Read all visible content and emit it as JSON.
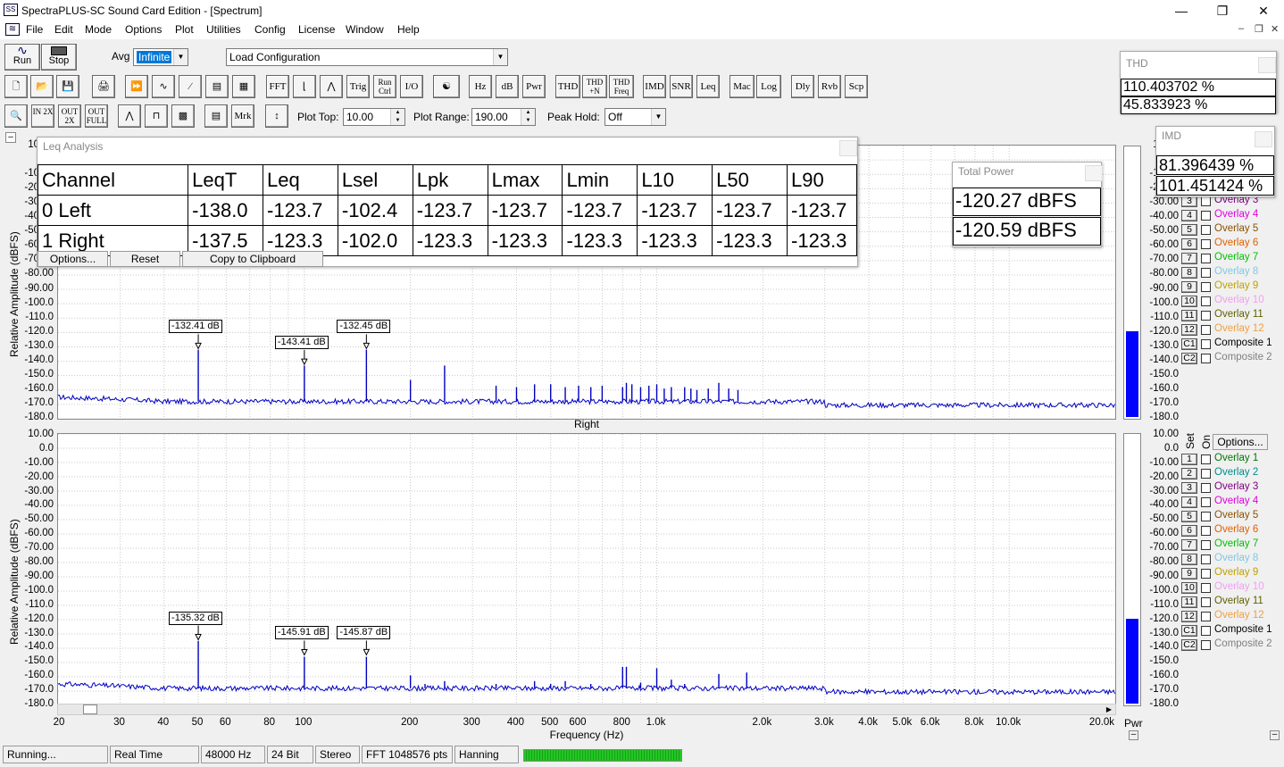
{
  "window": {
    "title": "SpectraPLUS-SC Sound Card Edition - [Spectrum]",
    "icon_text": "SS"
  },
  "menu": [
    "File",
    "Edit",
    "Mode",
    "Options",
    "Plot",
    "Utilities",
    "Config",
    "License",
    "Window",
    "Help"
  ],
  "toolbar1": {
    "run": "Run",
    "stop": "Stop",
    "avg_label": "Avg",
    "avg_value": "Infinite",
    "config_value": "Load Configuration"
  },
  "toolbar2": [
    "FFT",
    "Trig",
    "Run Ctrl",
    "I/O",
    "Hz",
    "dB",
    "Pwr",
    "THD",
    "THD +N",
    "THD Freq",
    "IMD",
    "SNR",
    "Leq",
    "Mac",
    "Log",
    "Dly",
    "Rvb",
    "Scp"
  ],
  "toolbar3": {
    "zoom_in": "IN 2X",
    "zoom_out": "OUT 2X",
    "zoom_full": "OUT FULL",
    "mrk": "Mrk",
    "plot_top_label": "Plot Top:",
    "plot_top_value": "10.00",
    "plot_range_label": "Plot Range:",
    "plot_range_value": "190.00",
    "peak_hold_label": "Peak Hold:",
    "peak_hold_value": "Off"
  },
  "thd": {
    "title": "THD",
    "values": [
      "110.403702 %",
      "45.833923 %"
    ]
  },
  "imd": {
    "title": "IMD",
    "values": [
      "81.396439 %",
      "101.451424 %"
    ]
  },
  "total_power": {
    "title": "Total Power",
    "values": [
      "-120.27 dBFS",
      "-120.59 dBFS"
    ]
  },
  "leq": {
    "title": "Leq Analysis",
    "headers": [
      "Channel",
      "LeqT",
      "Leq",
      "Lsel",
      "Lpk",
      "Lmax",
      "Lmin",
      "L10",
      "L50",
      "L90"
    ],
    "rows": [
      [
        "0 Left",
        "-138.0",
        "-123.7",
        "-102.4",
        "-123.7",
        "-123.7",
        "-123.7",
        "-123.7",
        "-123.7",
        "-123.7"
      ],
      [
        "1 Right",
        "-137.5",
        "-123.3",
        "-102.0",
        "-123.3",
        "-123.3",
        "-123.3",
        "-123.3",
        "-123.3",
        "-123.3"
      ]
    ],
    "buttons": [
      "Options...",
      "Reset",
      "Copy to Clipboard"
    ]
  },
  "plots": {
    "ylabel": "Relative Amplitude (dBFS)",
    "right_title": "Right",
    "xlabel": "Frequency (Hz)",
    "pwr_label": "Pwr",
    "left_yticks": [
      "10.00",
      "0.0",
      "-10.00",
      "-20.00",
      "-30.00",
      "-40.00",
      "-50.00",
      "-60.00",
      "-70.00",
      "-80.00",
      "-90.00",
      "-100.0",
      "-110.0",
      "-120.0",
      "-130.0",
      "-140.0",
      "-150.0",
      "-160.0",
      "-170.0",
      "-180.0"
    ],
    "right_yticks": [
      "10.00",
      "0.0",
      "-10.00",
      "-20.00",
      "-30.00",
      "-40.00",
      "-50.00",
      "-60.00",
      "-70.00",
      "-80.00",
      "-90.00",
      "-100.0",
      "-110.0",
      "-120.0",
      "-130.0",
      "-140.0",
      "-150.0",
      "-160.0",
      "-170.0",
      "-180.0"
    ],
    "xticks": [
      "20",
      "30",
      "40",
      "50",
      "60",
      "80",
      "100",
      "200",
      "300",
      "400",
      "500",
      "600",
      "800",
      "1.0k",
      "2.0k",
      "3.0k",
      "4.0k",
      "5.0k",
      "6.0k",
      "8.0k",
      "10.0k",
      "20.0k"
    ],
    "top_markers": [
      "-132.41 dB",
      "-143.41 dB",
      "-132.45 dB"
    ],
    "bottom_markers": [
      "-135.32 dB",
      "-145.91 dB",
      "-145.87 dB"
    ],
    "set_label": "Set",
    "on_label": "On",
    "options_button": "Options...",
    "overlays": [
      {
        "num": "1",
        "name": "Overlay 1",
        "color": "#007800"
      },
      {
        "num": "2",
        "name": "Overlay 2",
        "color": "#008c8c"
      },
      {
        "num": "3",
        "name": "Overlay 3",
        "color": "#800080"
      },
      {
        "num": "4",
        "name": "Overlay 4",
        "color": "#e000e0"
      },
      {
        "num": "5",
        "name": "Overlay 5",
        "color": "#8c5000"
      },
      {
        "num": "6",
        "name": "Overlay 6",
        "color": "#e06000"
      },
      {
        "num": "7",
        "name": "Overlay 7",
        "color": "#00c000"
      },
      {
        "num": "8",
        "name": "Overlay 8",
        "color": "#80c8e0"
      },
      {
        "num": "9",
        "name": "Overlay 9",
        "color": "#c0a000"
      },
      {
        "num": "10",
        "name": "Overlay 10",
        "color": "#f0a0f0"
      },
      {
        "num": "11",
        "name": "Overlay 11",
        "color": "#606000"
      },
      {
        "num": "12",
        "name": "Overlay 12",
        "color": "#f0a040"
      },
      {
        "num": "C1",
        "name": "Composite 1",
        "color": "#000000"
      },
      {
        "num": "C2",
        "name": "Composite 2",
        "color": "#808080"
      }
    ]
  },
  "status": [
    "Running...",
    "Real Time",
    "48000 Hz",
    "24 Bit",
    "Stereo",
    "FFT 1048576 pts",
    "Hanning"
  ]
}
